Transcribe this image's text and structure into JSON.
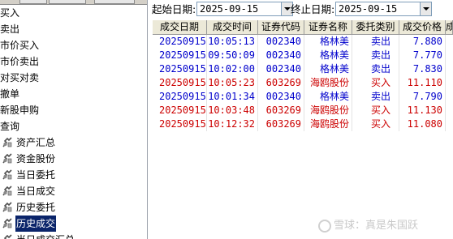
{
  "sidebar": {
    "menu": [
      "买入",
      "卖出",
      "市价买入",
      "市价卖出",
      "对买对卖",
      "撤单",
      "新股申购",
      "查询"
    ],
    "query_items": [
      {
        "label": "资产汇总"
      },
      {
        "label": "资金股份"
      },
      {
        "label": "当日委托"
      },
      {
        "label": "当日成交"
      },
      {
        "label": "历史委托"
      },
      {
        "label": "历史成交",
        "selected": true
      },
      {
        "label": "当日成交汇总"
      }
    ]
  },
  "filter": {
    "start_label": "起始日期:",
    "start_value": "2025-09-15",
    "end_label": "终止日期:",
    "end_value": "2025-09-15"
  },
  "table": {
    "columns": [
      "成交日期",
      "成交时间",
      "证券代码",
      "证券名称",
      "委托类别",
      "成交价格",
      "成"
    ],
    "rows": [
      {
        "date": "20250915",
        "time": "10:05:13",
        "code": "002340",
        "name": "格林美",
        "side": "卖出",
        "price": "7.880",
        "kind": "sell"
      },
      {
        "date": "20250915",
        "time": "09:50:09",
        "code": "002340",
        "name": "格林美",
        "side": "卖出",
        "price": "7.770",
        "kind": "sell"
      },
      {
        "date": "20250915",
        "time": "10:02:00",
        "code": "002340",
        "name": "格林美",
        "side": "卖出",
        "price": "7.830",
        "kind": "sell"
      },
      {
        "date": "20250915",
        "time": "10:05:23",
        "code": "603269",
        "name": "海鸥股份",
        "side": "买入",
        "price": "11.110",
        "kind": "buy"
      },
      {
        "date": "20250915",
        "time": "10:01:34",
        "code": "002340",
        "name": "格林美",
        "side": "卖出",
        "price": "7.790",
        "kind": "sell"
      },
      {
        "date": "20250915",
        "time": "10:03:48",
        "code": "603269",
        "name": "海鸥股份",
        "side": "买入",
        "price": "11.130",
        "kind": "buy"
      },
      {
        "date": "20250915",
        "time": "10:12:32",
        "code": "603269",
        "name": "海鸥股份",
        "side": "买入",
        "price": "11.080",
        "kind": "buy"
      }
    ]
  },
  "colors": {
    "buy": "#cc0000",
    "sell": "#0000cc",
    "selection": "#0a246a"
  },
  "watermark": "雪球：真是朱国跃"
}
